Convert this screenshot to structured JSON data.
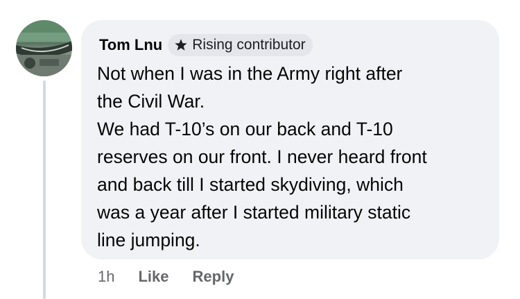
{
  "comment": {
    "author": "Tom Lnu",
    "badge": {
      "icon": "star-icon",
      "label": "Rising contributor"
    },
    "text_lines": [
      "Not when I was in the Army right after",
      "the Civil War.",
      "We had T-10’s on our back and T-10",
      "reserves on our front. I never heard front",
      "and back till I started skydiving, which",
      "was a year after I started military static",
      "line jumping."
    ],
    "timestamp": "1h",
    "actions": {
      "like": "Like",
      "reply": "Reply"
    }
  },
  "colors": {
    "bubble": "#f0f2f5",
    "badge_bg": "#e4e6eb",
    "text": "#050505",
    "secondary_text": "#65676b",
    "thread_line": "#d6d9de"
  }
}
